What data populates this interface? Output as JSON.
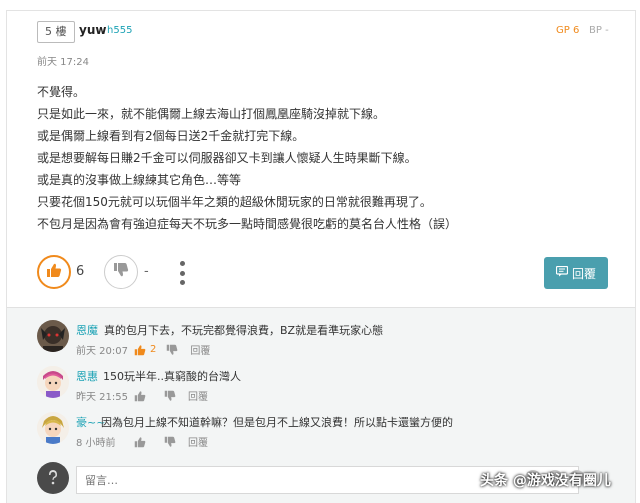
{
  "post": {
    "floor": "5 樓",
    "username": "yuw",
    "user_id": "h555",
    "gp": "GP 6",
    "bp": "BP -",
    "time": "前天 17:24",
    "lines": [
      "不覺得。",
      "只是如此一來，就不能偶爾上線去海山打個鳳凰座騎沒掉就下線。",
      "或是偶爾上線看到有2個每日送2千金就打完下線。",
      "或是想要解每日賺2千金可以伺服器卻又卡到讓人懷疑人生時果斷下線。",
      "或是真的沒事做上線練其它角色…等等",
      "只要花個150元就可以玩個半年之類的超級休閒玩家的日常就很難再現了。",
      "不包月是因為會有強迫症每天不玩多一點時間感覺很吃虧的莫名台人性格（誤）"
    ],
    "like_count": "6",
    "dislike_count": "-",
    "reply_label": "回覆"
  },
  "comments": [
    {
      "name": "恩魔",
      "text": "真的包月下去，不玩完都覺得浪費，BZ就是看準玩家心態",
      "time": "前天 20:07",
      "likes": "2",
      "reply_label": "回覆"
    },
    {
      "name": "恩惠",
      "text": "150玩半年..真窮酸的台灣人",
      "time": "昨天 21:55",
      "likes": "",
      "reply_label": "回覆"
    },
    {
      "name": "豪~~",
      "text": "因為包月上線不知道幹嘛？但是包月不上線又浪費！所以點卡還蠻方便的",
      "time": "8 小時前",
      "likes": "",
      "reply_label": "回覆"
    }
  ],
  "comment_input": {
    "placeholder": "留言…"
  },
  "watermark": "头条 @游戏没有圈儿",
  "colors": {
    "accent_orange": "#f08a1c",
    "link_teal": "#1ca2b5",
    "reply_button": "#4a9fae"
  }
}
